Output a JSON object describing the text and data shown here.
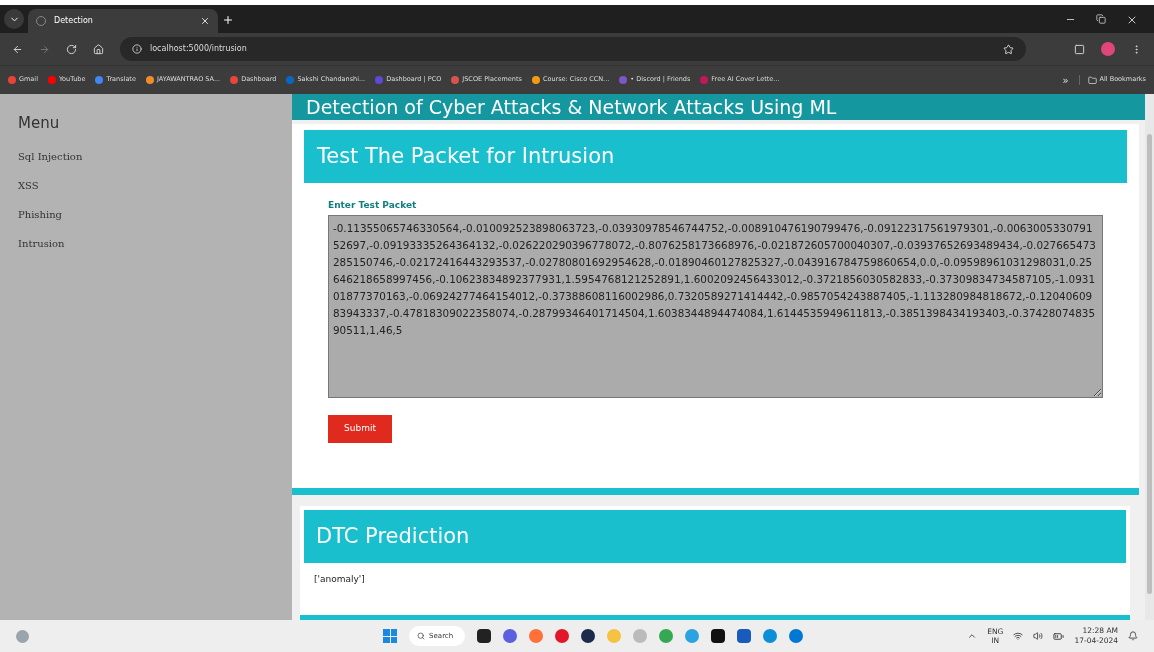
{
  "browser": {
    "tab": {
      "title": "Detection",
      "selected": true
    },
    "address": "localhost:5000/intrusion",
    "bookmarks": [
      "Gmail",
      "YouTube",
      "Translate",
      "JAYAWANTRAO SA...",
      "Dashboard",
      "Sakshi Chandanshi...",
      "Dashboard | PCO",
      "JSCOE Placements",
      "Course: Cisco CCN...",
      "• Discord | Friends",
      "Free AI Cover Lette..."
    ],
    "more_bookmarks": "»",
    "all_bookmarks": "All Bookmarks"
  },
  "sidebar": {
    "title": "Menu",
    "items": [
      "Sql Injection",
      "XSS",
      "Phishing",
      "Intrusion"
    ]
  },
  "page_heading": "Detection of Cyber Attacks & Network Attacks Using ML",
  "form_card": {
    "title": "Test The Packet for Intrusion",
    "label": "Enter Test Packet",
    "value": "-0.11355065746330564,-0.010092523898063723,-0.03930978546744752,-0.008910476190799476,-0.09122317561979301,-0.006300533079152697,-0.09193335264364132,-0.026220290396778072,-0.8076258173668976,-0.021872605700040307,-0.03937652693489434,-0.027665473285150746,-0.02172416443293537,-0.02780801692954628,-0.01890460127825327,-0.043916784759860654,0.0,-0.09598961031298031,0.25646218658997456,-0.10623834892377931,1.5954768121252891,1.6002092456433012,-0.3721856030582833,-0.37309834734587105,-1.093101877370163,-0.06924277464154012,-0.37388608116002986,0.7320589271414442,-0.9857054243887405,-1.113280984818672,-0.1204060983943337,-0.47818309022358074,-0.28799346401714504,1.6038344894474084,1.6144535949611813,-0.3851398434193403,-0.3742807483590511,1,46,5",
    "button": "Submit"
  },
  "result_card": {
    "title": "DTC Prediction",
    "result": "['anomaly']"
  },
  "taskbar": {
    "search": "Search",
    "language": "ENG",
    "region": "IN",
    "time": "12:28 AM",
    "date": "17-04-2024"
  }
}
